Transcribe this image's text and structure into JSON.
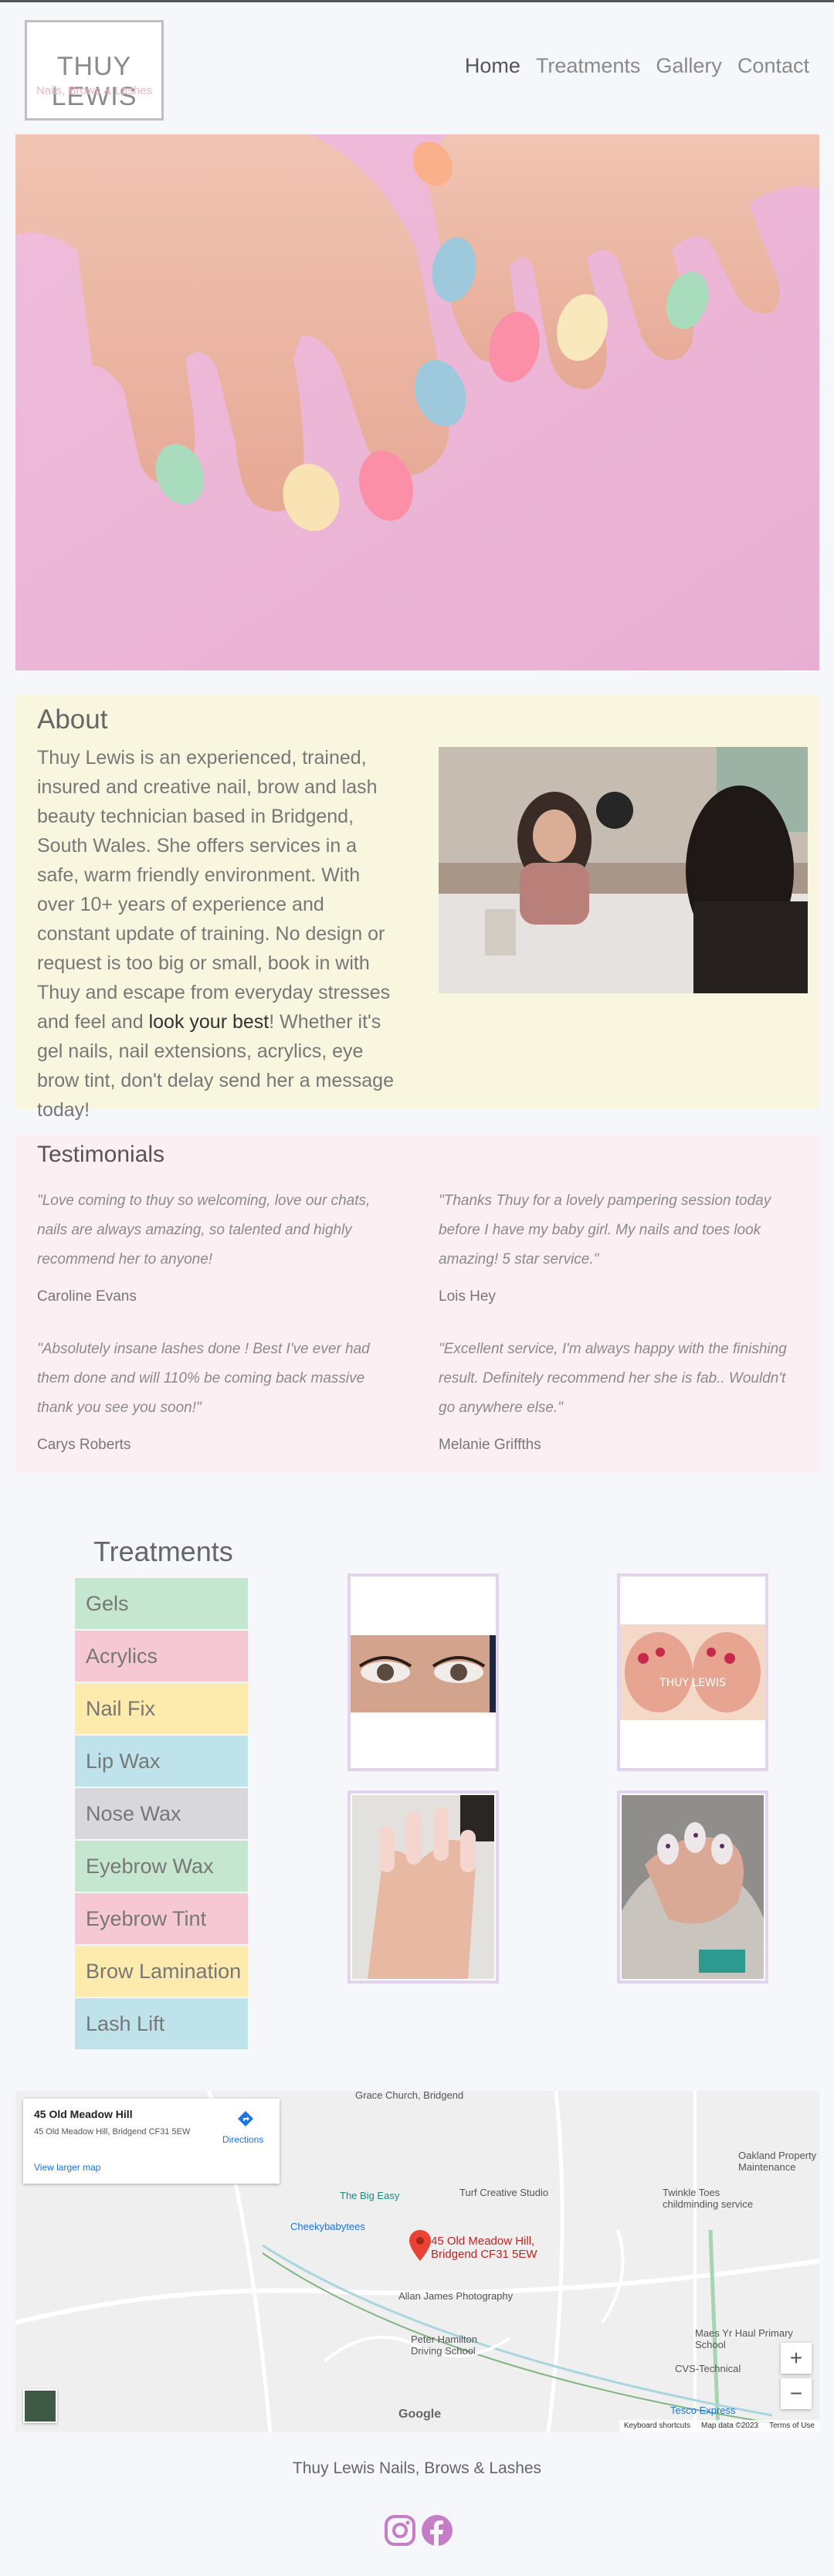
{
  "header": {
    "logo_title": "THUY LEWIS",
    "logo_subtitle": "Nails, Brows & Lashes",
    "nav": [
      "Home",
      "Treatments",
      "Gallery",
      "Contact"
    ]
  },
  "about": {
    "heading": "About",
    "text_before": "Thuy Lewis is an experienced, trained, insured and creative nail, brow and lash beauty technician based in Bridgend, South Wales. She offers services in a safe, warm friendly environment. With over 10+ years of experience and constant update of training. No design or request is too big or small, book in with Thuy and escape from everyday stresses and feel and ",
    "text_emphasis": "look your best",
    "text_after": "! Whether it's gel nails, nail extensions, acrylics, eye brow tint, don't delay send her a message today!"
  },
  "testimonials": {
    "heading": "Testimonials",
    "items": [
      {
        "quote": "\"Love coming to thuy so welcoming, love our chats, nails are always amazing, so talented and highly recommend her to anyone!",
        "name": "Caroline Evans"
      },
      {
        "quote": "\"Thanks Thuy for a lovely pampering session today before I have my baby girl. My nails and toes look amazing! 5 star service.\"",
        "name": "Lois Hey"
      },
      {
        "quote": "\"Absolutely insane lashes done ! Best I've ever had them done and will 110% be coming back massive thank you see you soon!\"",
        "name": "Carys Roberts"
      },
      {
        "quote": "\"Excellent service, I'm always happy with the finishing result. Definitely recommend her she is fab.. Wouldn't go anywhere else.\"",
        "name": "Melanie Griffths"
      }
    ]
  },
  "treatments": {
    "heading": "Treatments",
    "items": [
      {
        "label": "Gels",
        "color": "#c6e7cf"
      },
      {
        "label": "Acrylics",
        "color": "#f5c8d3"
      },
      {
        "label": "Nail Fix",
        "color": "#fdebae"
      },
      {
        "label": "Lip Wax",
        "color": "#bfe3ea"
      },
      {
        "label": "Nose Wax",
        "color": "#d8d8dc"
      },
      {
        "label": "Eyebrow Wax",
        "color": "#c6e7cf"
      },
      {
        "label": "Eyebrow Tint",
        "color": "#f5c8d3"
      },
      {
        "label": "Brow Lamination",
        "color": "#fdebae"
      },
      {
        "label": "Lash Lift",
        "color": "#bfe3ea"
      }
    ],
    "gallery_watermark": "THUY LEWIS"
  },
  "map": {
    "card_title": "45 Old Meadow Hill",
    "card_address": "45 Old Meadow Hill, Bridgend CF31 5EW",
    "card_link": "View larger map",
    "card_directions": "Directions",
    "places": {
      "grace": "Grace Church, Bridgend",
      "oakland": "Oakland Property Maintenance",
      "bigeasy": "The Big Easy",
      "turf": "Turf Creative Studio",
      "twinkle": "Twinkle Toes childminding service",
      "cheeky": "Cheekybabytees",
      "marker": "45 Old Meadow Hill, Bridgend CF31 5EW",
      "allan": "Allan James Photography",
      "peter": "Peter Hamilton Driving School",
      "maes": "Maes Yr Haul Primary School",
      "cvs": "CVS-Technical",
      "tesco": "Tesco Express"
    },
    "google": "Google",
    "footer": [
      "Keyboard shortcuts",
      "Map data ©2023",
      "Terms of Use"
    ]
  },
  "footer": {
    "text": "Thuy Lewis Nails, Brows & Lashes"
  }
}
